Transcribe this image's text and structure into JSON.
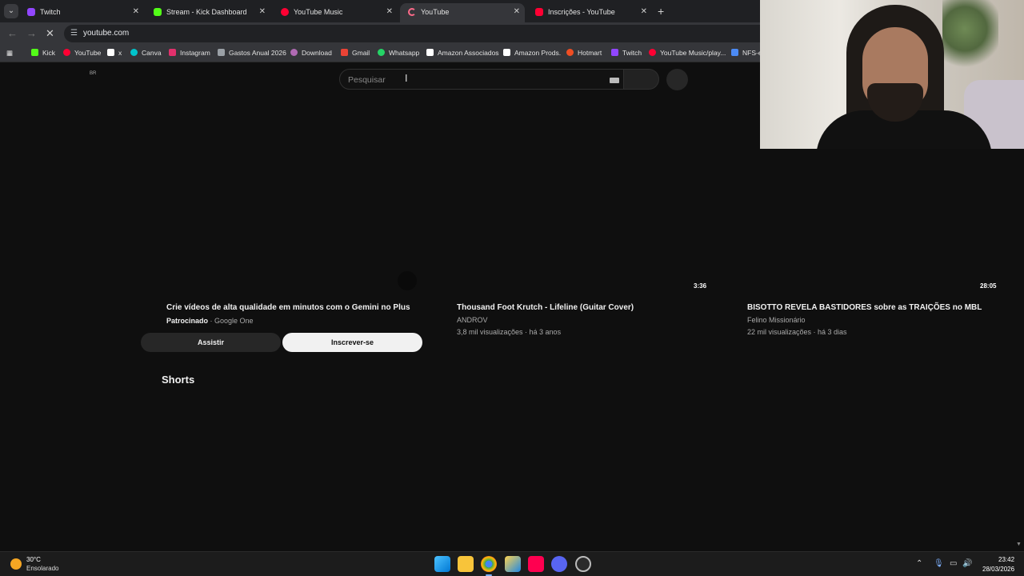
{
  "browser": {
    "tabs": [
      {
        "label": "Twitch",
        "color": "#9146ff",
        "active": false
      },
      {
        "label": "Stream - Kick Dashboard",
        "color": "#53fc18",
        "active": false
      },
      {
        "label": "YouTube Music",
        "color": "#ff0033",
        "active": false
      },
      {
        "label": "YouTube",
        "color": "#ff0033",
        "active": true
      },
      {
        "label": "Inscrições - YouTube",
        "color": "#ff0033",
        "active": false
      }
    ],
    "new_tab": "+",
    "url": "youtube.com",
    "bookmarks": [
      {
        "label": "Kick",
        "color": "#53fc18"
      },
      {
        "label": "YouTube",
        "color": "#ff0033"
      },
      {
        "label": "x",
        "color": "#ffffff"
      },
      {
        "label": "Canva",
        "color": "#00c4cc"
      },
      {
        "label": "Instagram",
        "color": "#e1306c"
      },
      {
        "label": "Gastos Anual 2026",
        "color": "#9aa0a6"
      },
      {
        "label": "Download",
        "color": "#b06ab3"
      },
      {
        "label": "Gmail",
        "color": "#ea4335"
      },
      {
        "label": "Whatsapp",
        "color": "#25d366"
      },
      {
        "label": "Amazon Associados",
        "color": "#ffffff"
      },
      {
        "label": "Amazon Prods.",
        "color": "#ffffff"
      },
      {
        "label": "Hotmart",
        "color": "#f04e23"
      },
      {
        "label": "Twitch",
        "color": "#9146ff"
      },
      {
        "label": "YouTube Music/play...",
        "color": "#ff0033"
      },
      {
        "label": "NFS-e",
        "color": "#4c8bf5"
      }
    ]
  },
  "youtube": {
    "region": "BR",
    "search_placeholder": "Pesquisar",
    "ad": {
      "title": "Crie vídeos de alta qualidade em minutos com o Gemini no Plus",
      "sponsored": "Patrocinado",
      "advertiser": "· Google One",
      "watch_button": "Assistir",
      "subscribe_button": "Inscrever-se"
    },
    "videos": [
      {
        "duration": "3:36",
        "title": "Thousand Foot Krutch - Lifeline (Guitar Cover)",
        "channel": "ANDROV",
        "stats": "3,8 mil visualizações · há 3 anos"
      },
      {
        "duration": "28:05",
        "title": "BISOTTO REVELA BASTIDORES sobre as TRAIÇÕES no MBL",
        "channel": "Felino Missionário",
        "stats": "22 mil visualizações · há 3 dias"
      }
    ],
    "shorts_heading": "Shorts"
  },
  "taskbar": {
    "weather_temp": "30°C",
    "weather_desc": "Ensolarado",
    "time": "23:42",
    "date": "28/03/2026"
  }
}
